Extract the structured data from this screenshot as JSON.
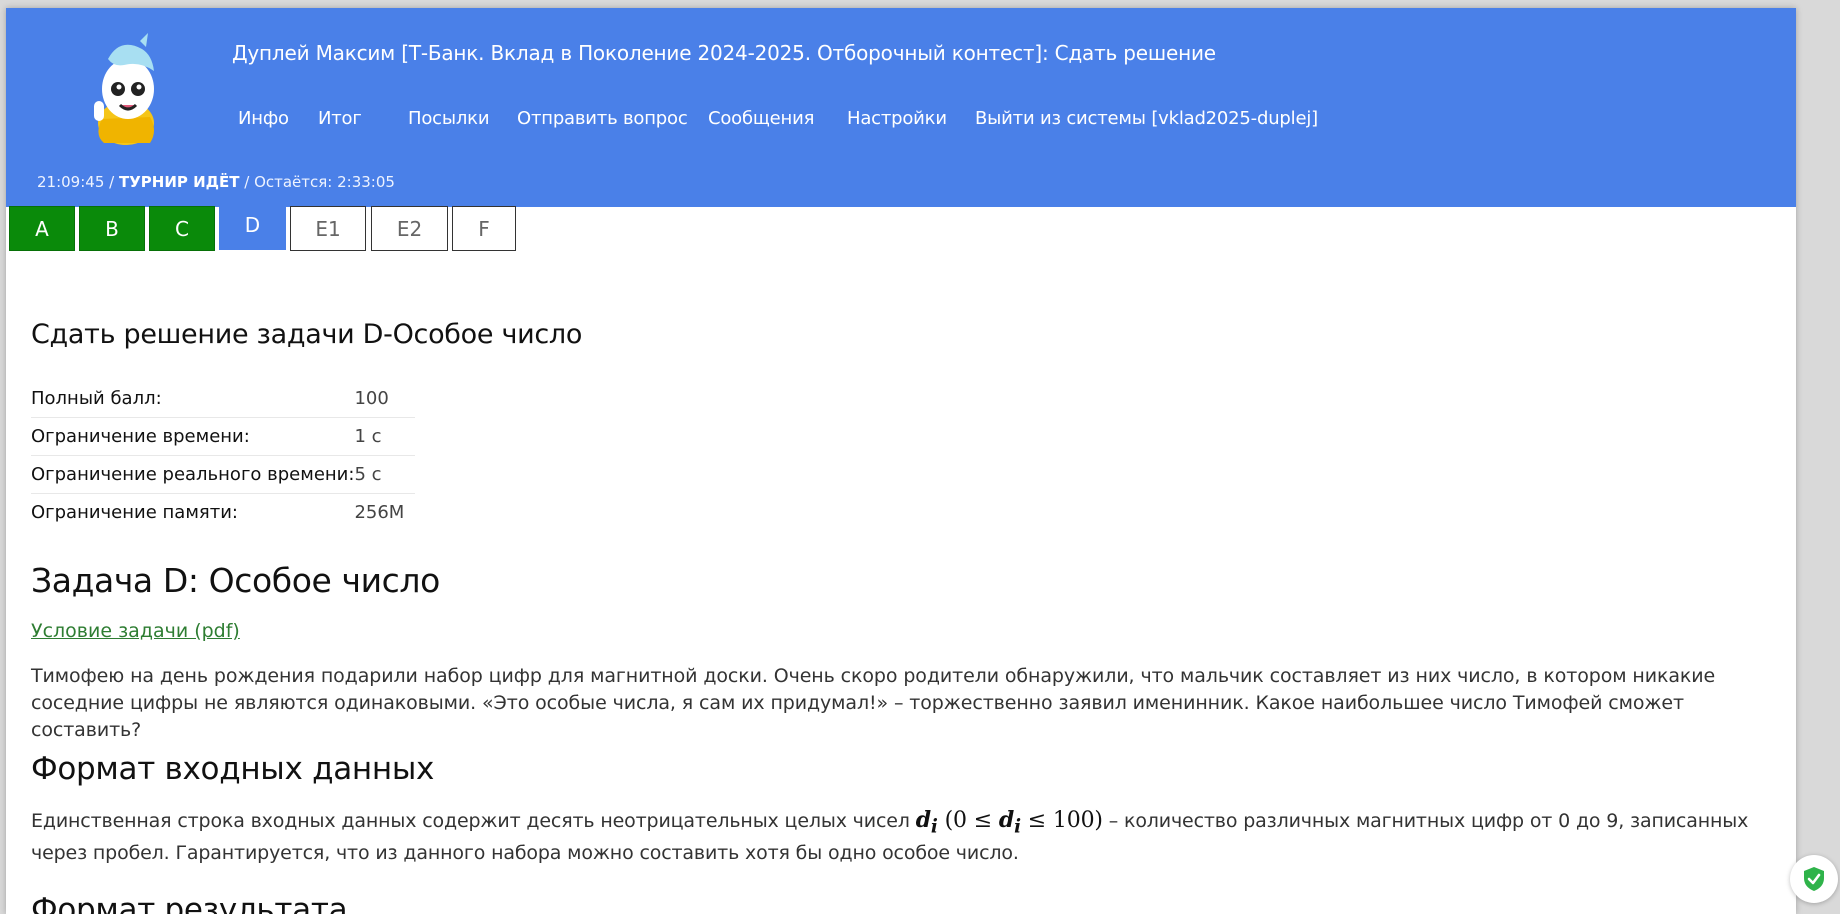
{
  "header": {
    "title": "Дуплей Максим [Т-Банк. Вклад в Поколение 2024-2025. Отборочный контест]: Сдать решение",
    "menu": [
      {
        "label": "Инфо"
      },
      {
        "label": "Итог"
      },
      {
        "label": "Посылки"
      },
      {
        "label": "Отправить вопрос"
      },
      {
        "label": "Сообщения"
      },
      {
        "label": "Настройки"
      },
      {
        "label": "Выйти из системы [vklad2025-duplej]"
      }
    ],
    "status": {
      "time": "21:09:45",
      "sep1": " / ",
      "state": "ТУРНИР ИДЁТ",
      "remaining": " / Остаётся: 2:33:05"
    },
    "background_color": "#4a80e8"
  },
  "problem_tabs": [
    {
      "label": "A",
      "state": "solved"
    },
    {
      "label": "B",
      "state": "solved"
    },
    {
      "label": "C",
      "state": "solved"
    },
    {
      "label": "D",
      "state": "current"
    },
    {
      "label": "E1",
      "state": "unsolved"
    },
    {
      "label": "E2",
      "state": "unsolved"
    },
    {
      "label": "F",
      "state": "unsolved"
    }
  ],
  "submit": {
    "title": "Сдать решение задачи D-Особое число",
    "limits": [
      {
        "key": "Полный балл:",
        "value": "100"
      },
      {
        "key": "Ограничение времени:",
        "value": "1 с"
      },
      {
        "key": "Ограничение реального времени:",
        "value": "5 с"
      },
      {
        "key": "Ограничение памяти:",
        "value": "256M"
      }
    ]
  },
  "task": {
    "title": "Задача D: Особое число",
    "pdf_link": "Условие задачи (pdf)",
    "statement": "Тимофею на день рождения подарили набор цифр для магнитной доски. Очень скоро родители обнаружили, что мальчик составляет из них число, в котором никакие соседние цифры не являются одинаковыми. «Это особые числа, я сам их придумал!» – торжественно заявил именинник. Какое наибольшее число Тимофей сможет составить?",
    "input_heading": "Формат входных данных",
    "input_before": "Единственная строка входных данных содержит десять неотрицательных целых чисел ",
    "input_var": "d",
    "input_sub": "i",
    "input_range_open": " (0 ≤ ",
    "input_range_close": " ≤ 100)",
    "input_after": " – количество различных магнитных цифр от 0 до 9, записанных через пробел. Гарантируется, что из данного набора можно составить хотя бы одно особое число.",
    "output_heading": "Формат результата"
  }
}
